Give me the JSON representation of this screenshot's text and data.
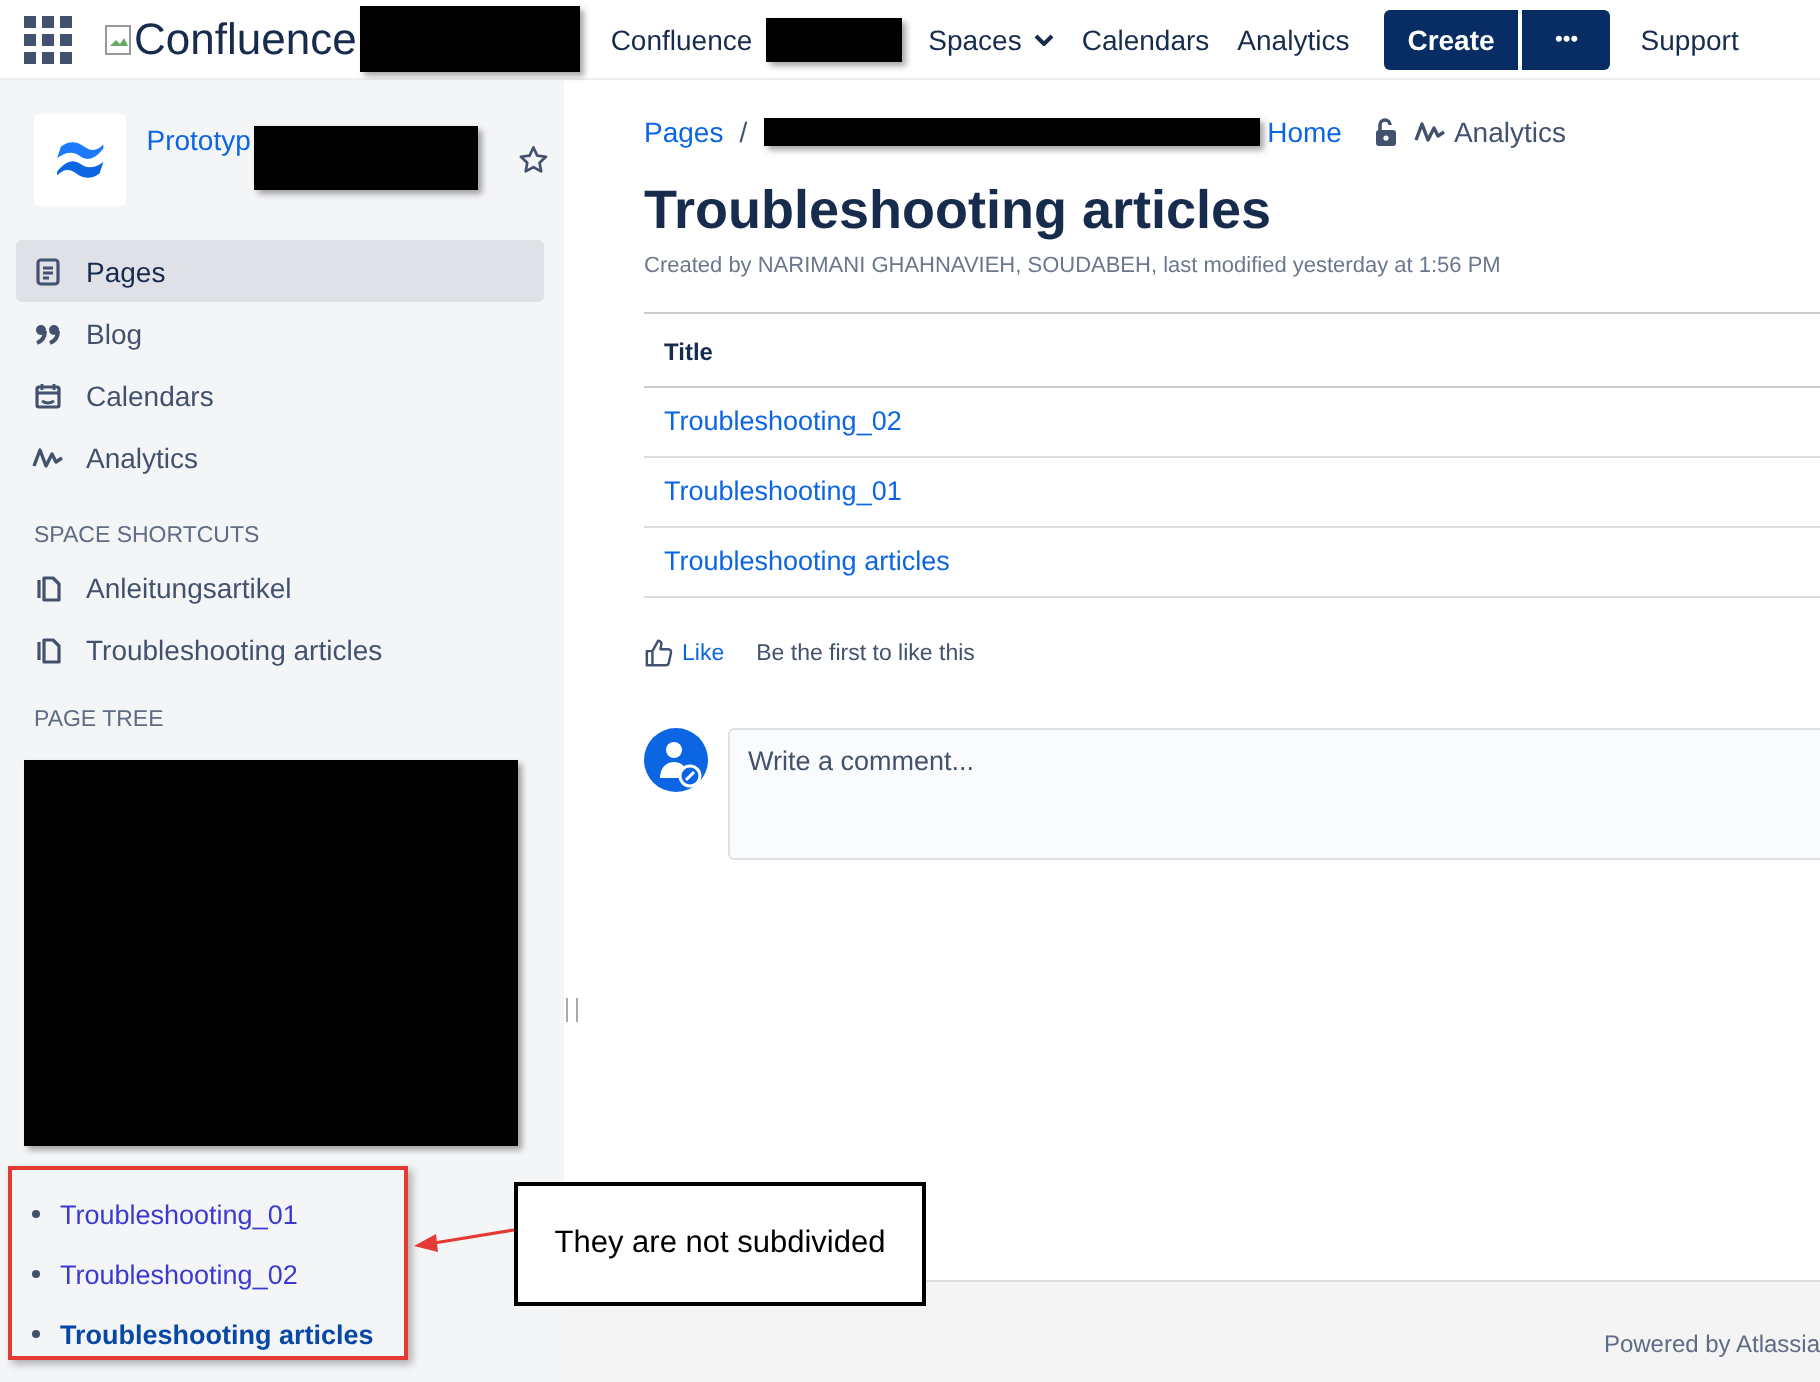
{
  "header": {
    "logo_text": "Confluence",
    "logo_redacted": true,
    "nav": [
      {
        "label": "Confluence",
        "kind": "link",
        "redacted": true
      },
      {
        "label": "Spaces",
        "kind": "dropdown",
        "redacted": false
      },
      {
        "label": "Calendars",
        "kind": "link",
        "redacted": false
      },
      {
        "label": "Analytics",
        "kind": "link",
        "redacted": false
      }
    ],
    "create_button": "Create",
    "more_button": "•••",
    "support": "Support"
  },
  "sidebar": {
    "space_name": "Prototyp",
    "space_redacted": true,
    "starred": false,
    "nav": [
      {
        "label": "Pages",
        "selected": true
      },
      {
        "label": "Blog",
        "selected": false
      },
      {
        "label": "Calendars",
        "selected": false
      },
      {
        "label": "Analytics",
        "selected": false
      }
    ],
    "shortcuts_heading": "SPACE SHORTCUTS",
    "shortcuts": [
      {
        "label": "Anleitungsartikel"
      },
      {
        "label": "Troubleshooting articles"
      }
    ],
    "page_tree_heading": "PAGE TREE",
    "page_tree_redacted": true,
    "page_tree": [
      {
        "label": "Troubleshooting_01",
        "selected": false
      },
      {
        "label": "Troubleshooting_02",
        "selected": false
      },
      {
        "label": "Troubleshooting articles",
        "selected": true
      }
    ]
  },
  "main": {
    "breadcrumb": [
      {
        "label": "Pages",
        "redacted": false
      },
      {
        "label": "Home",
        "redacted": true
      }
    ],
    "breadcrumb_separator": "/",
    "analytics": "Analytics",
    "title": "Troubleshooting articles",
    "byline": "Created by NARIMANI GHAHNAVIEH, SOUDABEH, last modified yesterday at 1:56 PM",
    "table": {
      "columns": [
        "Title"
      ],
      "rows": [
        [
          "Troubleshooting_02"
        ],
        [
          "Troubleshooting_01"
        ],
        [
          "Troubleshooting articles"
        ]
      ]
    },
    "like": "Like",
    "like_text": "Be the first to like this",
    "comment": {
      "placeholder": "Write a comment..."
    }
  },
  "footer": {
    "text": "Powered by Atlassia"
  },
  "annotation": {
    "text": "They are not subdivided"
  }
}
